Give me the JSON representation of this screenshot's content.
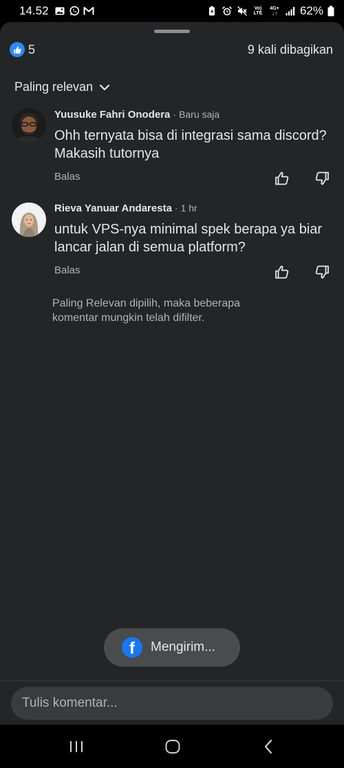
{
  "status_bar": {
    "time": "14.52",
    "left_icons": [
      "gallery-icon",
      "whatsapp-icon",
      "gmail-icon"
    ],
    "right_icons": [
      "battery-saver-icon",
      "alarm-icon",
      "mute-icon",
      "volte-icon",
      "4g-icon",
      "signal-icon"
    ],
    "volte_label": "Vo) LTE",
    "network_label": "4G+",
    "battery_percent": "62%"
  },
  "reactions": {
    "like_count": "5",
    "share_text": "9 kali dibagikan"
  },
  "sort": {
    "label": "Paling relevan"
  },
  "comments": [
    {
      "author": "Yuusuke Fahri Onodera",
      "separator": "·",
      "time": "Baru saja",
      "text": "Ohh ternyata bisa di integrasi sama discord? Makasih tutornya",
      "reply_label": "Balas"
    },
    {
      "author": "Rieva Yanuar Andaresta",
      "separator": "·",
      "time": "1 hr",
      "text": "untuk VPS-nya minimal spek berapa ya biar lancar jalan di semua platform?",
      "reply_label": "Balas"
    }
  ],
  "filter_note": "Paling Relevan dipilih, maka beberapa komentar mungkin telah difilter.",
  "toast": {
    "text": "Mengirim..."
  },
  "composer": {
    "placeholder": "Tulis komentar..."
  },
  "colors": {
    "background": "#242526",
    "accent": "#1877f2",
    "like_blue": "#2d88ff"
  }
}
